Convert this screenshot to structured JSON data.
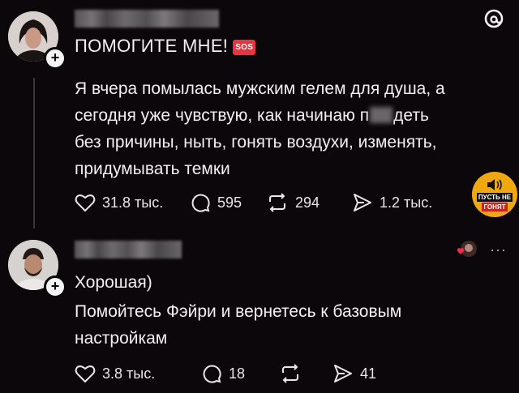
{
  "post": {
    "title": "ПОМОГИТЕ МНЕ!",
    "sos_badge": "SOS",
    "body_line1": "Я вчера помылась мужским гелем для душа, а",
    "body_line2_a": "сегодня уже чувствую, как начинаю п",
    "body_line2_b": "деть",
    "body_line3": "без причины, ныть, гонять воздухи, изменять,",
    "body_line4": "придумывать темки",
    "likes": "31.8 тыс.",
    "comments": "595",
    "reposts": "294",
    "shares": "1.2 тыс."
  },
  "reply": {
    "line1": "Хорошая)",
    "line2": "Помойтесь Фэйри и вернетесь к базовым",
    "line3": "настройкам",
    "likes": "3.8 тыс.",
    "comments": "18",
    "shares": "41",
    "more": "···"
  },
  "watermark": {
    "line1": "ПУСТЬ НЕ",
    "line2": "ГОНЯТ"
  },
  "colors": {
    "background": "#0b070a",
    "text": "#f2f0f1",
    "sos": "#e8343e",
    "badge": "#f0a811",
    "heart_red": "#e5304a"
  },
  "icons": [
    "threads-logo-icon",
    "heart-icon",
    "comment-icon",
    "repost-icon",
    "share-icon",
    "speaker-icon",
    "more-icon",
    "plus-icon"
  ]
}
